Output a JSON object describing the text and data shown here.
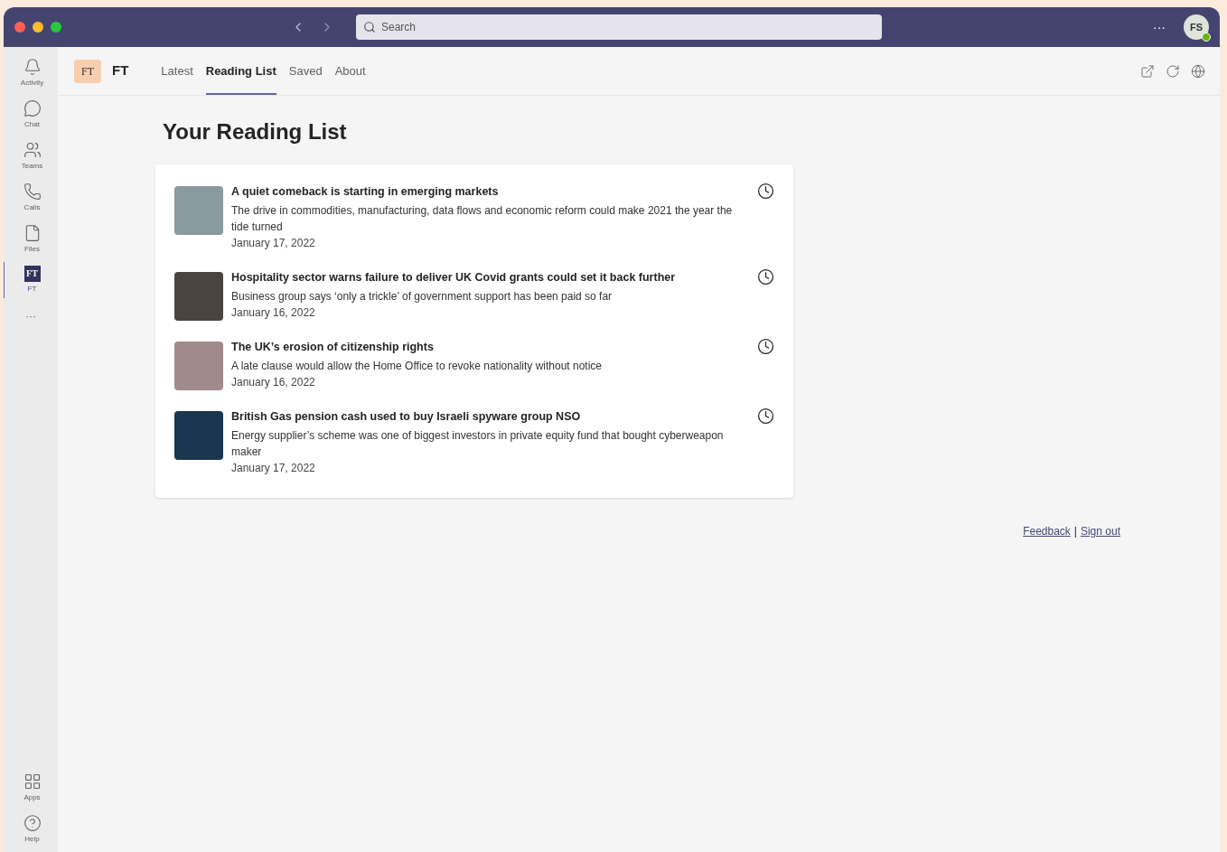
{
  "titlebar": {
    "search_placeholder": "Search",
    "more": "···",
    "avatar": "FS",
    "status_online": true
  },
  "sidebar": {
    "items": [
      {
        "kind": "activity",
        "label": "Activity",
        "selected": false
      },
      {
        "kind": "chat",
        "label": "Chat",
        "selected": false
      },
      {
        "kind": "teams",
        "label": "Teams",
        "selected": false
      },
      {
        "kind": "calls",
        "label": "Calls",
        "selected": false
      },
      {
        "kind": "files",
        "label": "Files",
        "selected": false
      },
      {
        "kind": "app",
        "label": "FT",
        "logo": "FT",
        "selected": true
      }
    ],
    "more": "···",
    "bottom": [
      {
        "kind": "apps",
        "label": "Apps",
        "selected": false
      },
      {
        "kind": "help",
        "label": "Help",
        "selected": false
      }
    ]
  },
  "app_header": {
    "logo": "FT",
    "name": "FT",
    "tabs": [
      {
        "label": "Latest",
        "selected": false
      },
      {
        "label": "Reading List",
        "selected": true
      },
      {
        "label": "Saved",
        "selected": false
      },
      {
        "label": "About",
        "selected": false
      }
    ]
  },
  "page_title": "Your Reading List",
  "articles": [
    {
      "title": "A quiet comeback is starting in emerging markets",
      "summary": "The drive in commodities, manufacturing, data flows and economic reform could make 2021 the year the tide turned",
      "date": "January 17, 2022",
      "color": "#8a9aa0"
    },
    {
      "title": "Hospitality sector warns failure to deliver UK Covid grants could set it back further",
      "summary": "Business group says ‘only a trickle’ of government support has been paid so far",
      "date": "January 16, 2022",
      "color": "#4a4440"
    },
    {
      "title": "The UK’s erosion of citizenship rights",
      "summary": "A late clause would allow the Home Office to revoke nationality without notice",
      "date": "January 16, 2022",
      "color": "#a08a8c"
    },
    {
      "title": "British Gas pension cash used to buy Israeli spyware group NSO",
      "summary": "Energy supplier’s scheme was one of biggest investors in private equity fund that bought cyberweapon maker",
      "date": "January 17, 2022",
      "color": "#1c3550"
    }
  ],
  "footer_links": [
    {
      "label": "Feedback"
    },
    {
      "label": "Sign out"
    }
  ],
  "footer_separator": "|"
}
